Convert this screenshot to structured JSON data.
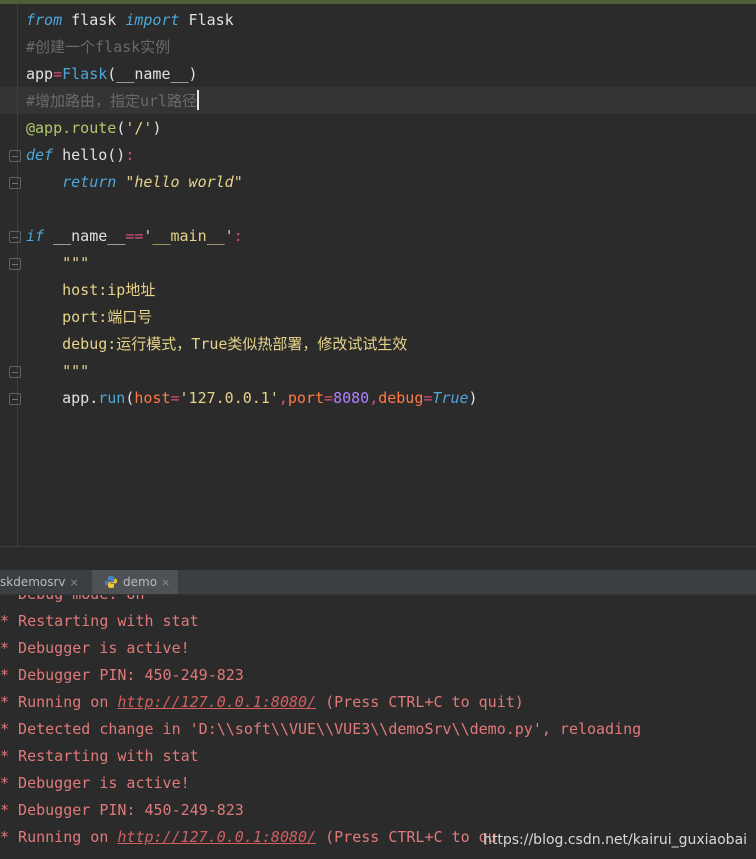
{
  "editor": {
    "line1": {
      "kw1": "from",
      "t1": " flask ",
      "kw2": "import",
      "t2": " Flask"
    },
    "line2": {
      "comment": "#创建一个flask实例"
    },
    "line3": {
      "t1": "app",
      "op": "=",
      "fn": "Flask",
      "t2": "(__name__)"
    },
    "line4": {
      "comment": "#增加路由，指定url路径"
    },
    "line5": {
      "dec": "@app.route",
      "t1": "(",
      "str": "'/'",
      "t2": ")"
    },
    "line6": {
      "kw": "def",
      "t1": " hello()",
      "op": ":"
    },
    "line7": {
      "indent": "    ",
      "kw": "return",
      "t1": " ",
      "str": "\"hello world\""
    },
    "line9": {
      "kw": "if",
      "t1": " __name__",
      "op": "==",
      "str": "'__main__'",
      "op2": ":"
    },
    "line10": {
      "str": "    \"\"\""
    },
    "line11": {
      "str": "    host:ip地址"
    },
    "line12": {
      "str": "    port:端口号"
    },
    "line13": {
      "str": "    debug:运行模式，True类似热部署，修改试试生效"
    },
    "line14": {
      "str": "    \"\"\""
    },
    "line15": {
      "indent": "    ",
      "t1": "app.",
      "fn": "run",
      "t2": "(",
      "p1": "host",
      "op1": "=",
      "s1": "'127.0.0.1'",
      "c1": ",",
      "p2": "port",
      "op2": "=",
      "n1": "8080",
      "c2": ",",
      "p3": "debug",
      "op3": "=",
      "b1": "True",
      "t3": ")"
    }
  },
  "tabs": [
    {
      "label": "skdemosrv",
      "close": "×"
    },
    {
      "label": "demo",
      "close": "×"
    }
  ],
  "console": {
    "lines": [
      "* Debug mode: on",
      "* Restarting with stat",
      "* Debugger is active!",
      "* Debugger PIN: 450-249-823",
      "* Running on ",
      "* Detected change in 'D:\\\\soft\\\\VUE\\\\VUE3\\\\demoSrv\\\\demo.py', reloading",
      "* Restarting with stat",
      "* Debugger is active!",
      "* Debugger PIN: 450-249-823",
      "* Running on "
    ],
    "link": "http://127.0.0.1:8080/",
    "suffix": " (Press CTRL+C to quit)",
    "suffix_partial": " (Press CTRL+C to qu"
  },
  "watermark": "https://blog.csdn.net/kairui_guxiaobai",
  "icons": {
    "fold": "fold-marker-icon",
    "python": "python-icon"
  }
}
